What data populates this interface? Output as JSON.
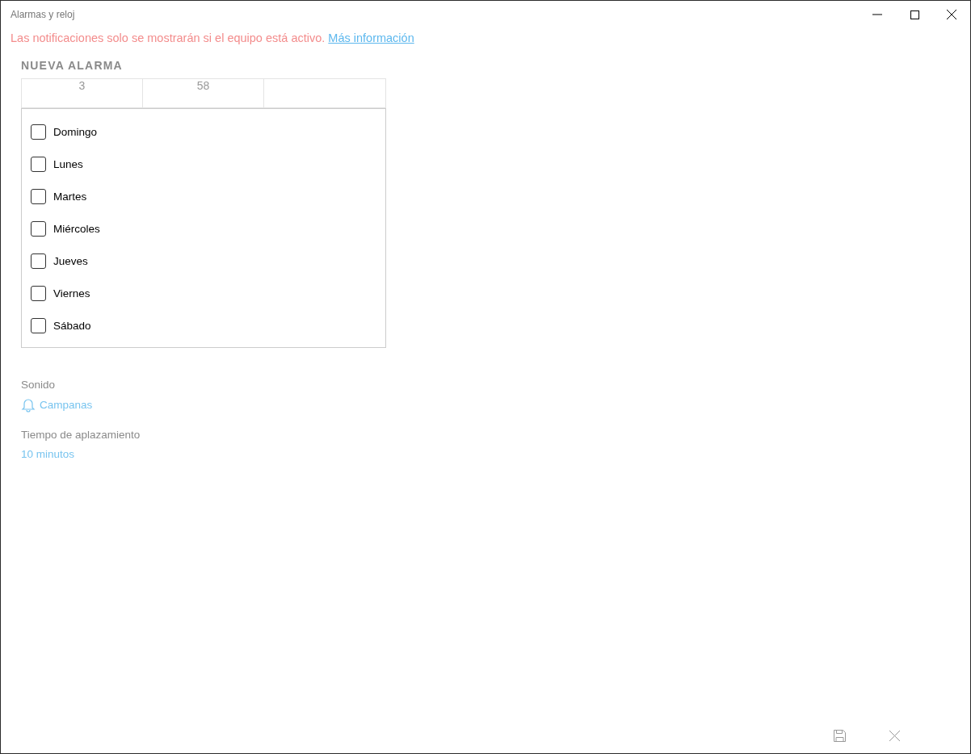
{
  "window": {
    "title": "Alarmas y reloj"
  },
  "notice": {
    "text": "Las notificaciones solo se mostrarán si el equipo está activo.",
    "link": "Más información"
  },
  "heading": "NUEVA ALARMA",
  "time_picker": [
    "3",
    "58"
  ],
  "days": [
    {
      "label": "Domingo",
      "checked": false
    },
    {
      "label": "Lunes",
      "checked": false
    },
    {
      "label": "Martes",
      "checked": false
    },
    {
      "label": "Miércoles",
      "checked": false
    },
    {
      "label": "Jueves",
      "checked": false
    },
    {
      "label": "Viernes",
      "checked": false
    },
    {
      "label": "Sábado",
      "checked": false
    }
  ],
  "sound": {
    "label": "Sonido",
    "value": "Campanas"
  },
  "snooze": {
    "label": "Tiempo de aplazamiento",
    "value": "10 minutos"
  }
}
